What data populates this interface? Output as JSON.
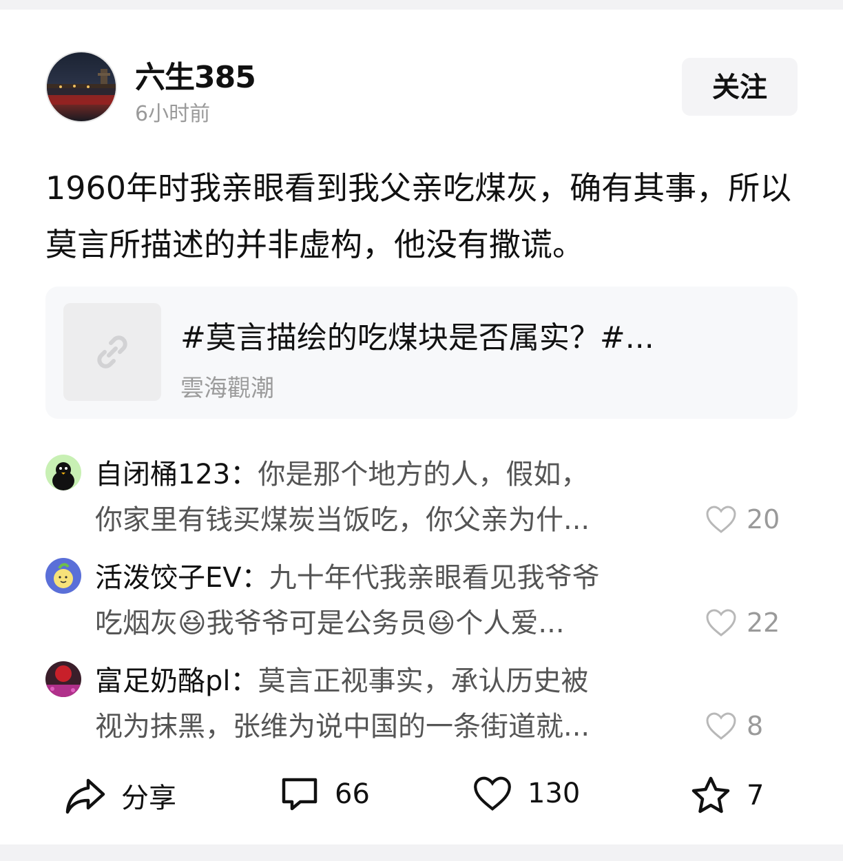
{
  "post": {
    "username": "六生385",
    "time": "6小时前",
    "follow_label": "关注",
    "content": "1960年时我亲眼看到我父亲吃煤灰，确有其事，所以莫言所描述的并非虚构，他没有撒谎。"
  },
  "link_card": {
    "title": "#莫言描绘的吃煤块是否属实？#...",
    "source": "雲海觀潮",
    "icon": "link-icon"
  },
  "comments": [
    {
      "author": "自闭桶123：",
      "text_line1": "你是那个地方的人，假如，",
      "text_line2": "你家里有钱买煤炭当饭吃，你父亲为什...",
      "likes": "20"
    },
    {
      "author": "活泼饺子EV：",
      "text_line1": "九十年代我亲眼看见我爷爷",
      "text_line2a": "吃烟灰",
      "text_line2b": "我爷爷可是公务员",
      "text_line2c": "个人爱...",
      "emoji": "😆",
      "likes": "22"
    },
    {
      "author": "富足奶酪pl：",
      "text_line1": "莫言正视事实，承认历史被",
      "text_line2": "视为抹黑，张维为说中国的一条街道就...",
      "likes": "8"
    }
  ],
  "actions": {
    "share_label": "分享",
    "comment_count": "66",
    "like_count": "130",
    "favorite_count": "7"
  }
}
